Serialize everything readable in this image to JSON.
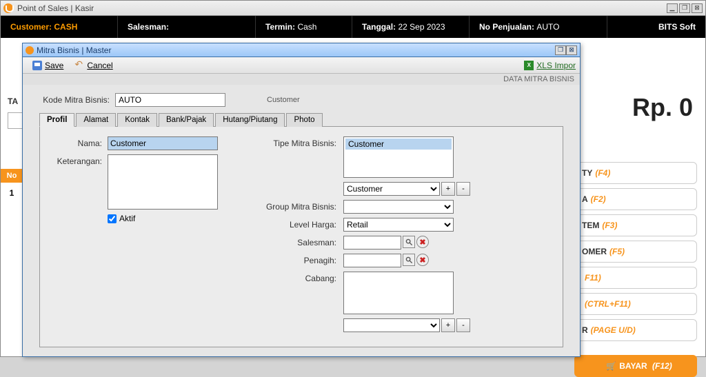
{
  "outer": {
    "title": "Point of Sales | Kasir"
  },
  "infobar": {
    "customer_label": "Customer:",
    "customer_value": "CASH",
    "salesman_label": "Salesman:",
    "salesman_value": "",
    "termin_label": "Termin:",
    "termin_value": "Cash",
    "tanggal_label": "Tanggal:",
    "tanggal_value": "22 Sep 2023",
    "nopenj_label": "No Penjualan:",
    "nopenj_value": "AUTO",
    "company": "BITS Soft"
  },
  "bg": {
    "total_text": "Rp. 0",
    "ta_label": "TA",
    "no_label": "No",
    "row1": "1",
    "buttons": [
      {
        "text": "TY",
        "key": "(F4)"
      },
      {
        "text": "A",
        "key": "(F2)"
      },
      {
        "text": "TEM",
        "key": "(F3)"
      },
      {
        "text": "OMER",
        "key": "(F5)"
      },
      {
        "text": "",
        "key": "F11)"
      },
      {
        "text": "",
        "key": "(CTRL+F11)"
      },
      {
        "text": "R",
        "key": "(PAGE U/D)"
      }
    ],
    "bayar": {
      "text": "BAYAR",
      "key": "(F12)"
    }
  },
  "modal": {
    "title": "Mitra Bisnis | Master",
    "toolbar": {
      "save": "Save",
      "cancel": "Cancel",
      "xls": "XLS Impor"
    },
    "data_strip": "DATA MITRA BISNIS",
    "kode_label": "Kode Mitra Bisnis:",
    "kode_value": "AUTO",
    "tipe_hint": "Customer",
    "tabs": [
      "Profil",
      "Alamat",
      "Kontak",
      "Bank/Pajak",
      "Hutang/Piutang",
      "Photo"
    ],
    "profil": {
      "nama_label": "Nama:",
      "nama_value": "Customer",
      "keterangan_label": "Keterangan:",
      "keterangan_value": "",
      "aktif_label": "Aktif",
      "aktif_checked": true,
      "tipe_label": "Tipe Mitra Bisnis:",
      "tipe_selected": "Customer",
      "tipe_dropdown": "Customer",
      "group_label": "Group Mitra Bisnis:",
      "group_value": "",
      "level_label": "Level Harga:",
      "level_value": "Retail",
      "salesman_label": "Salesman:",
      "salesman_value": "",
      "penagih_label": "Penagih:",
      "penagih_value": "",
      "cabang_label": "Cabang:"
    }
  }
}
